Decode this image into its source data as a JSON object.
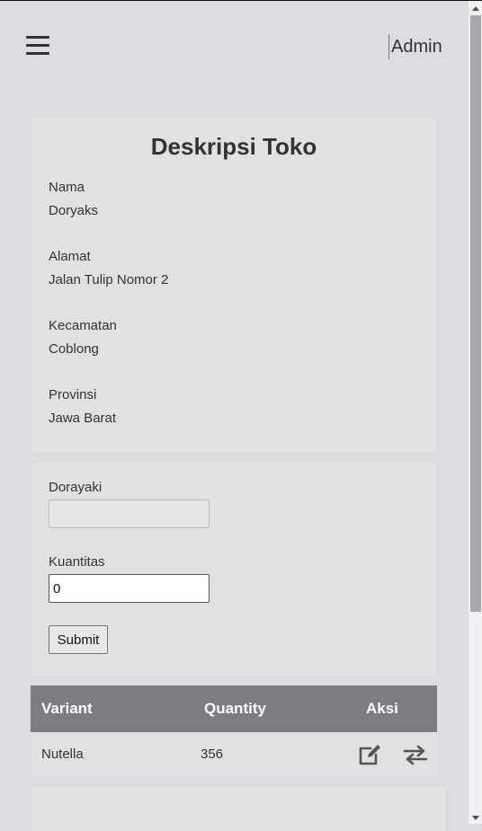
{
  "header": {
    "menu_icon": "hamburger-menu-icon",
    "user_label": "Admin"
  },
  "store": {
    "title": "Deskripsi Toko",
    "fields": [
      {
        "label": "Nama",
        "value": "Doryaks"
      },
      {
        "label": "Alamat",
        "value": "Jalan Tulip Nomor 2"
      },
      {
        "label": "Kecamatan",
        "value": "Coblong"
      },
      {
        "label": "Provinsi",
        "value": "Jawa Barat"
      }
    ]
  },
  "form": {
    "dorayaki_label": "Dorayaki",
    "dorayaki_value": "",
    "quantity_label": "Kuantitas",
    "quantity_value": "0",
    "submit_label": "Submit"
  },
  "table": {
    "headers": [
      "Variant",
      "Quantity",
      "Aksi"
    ],
    "rows": [
      {
        "variant": "Nutella",
        "quantity": "356",
        "actions": [
          "edit-icon",
          "transfer-icon"
        ]
      }
    ]
  },
  "colors": {
    "background": "#dcdde0",
    "card": "#e1e1e1",
    "table_header": "#7b7d82"
  }
}
